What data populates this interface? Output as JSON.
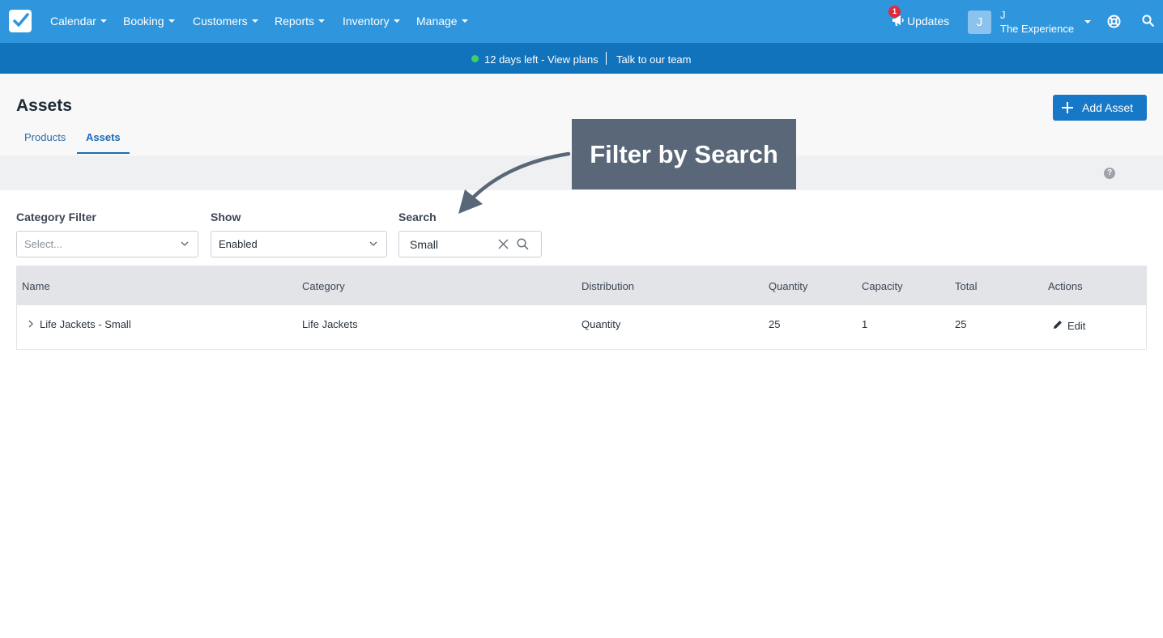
{
  "nav": {
    "items": [
      {
        "label": "Calendar"
      },
      {
        "label": "Booking"
      },
      {
        "label": "Customers"
      },
      {
        "label": "Reports"
      },
      {
        "label": "Inventory"
      },
      {
        "label": "Manage"
      }
    ],
    "updates_label": "Updates",
    "updates_count": "1",
    "user_avatar": "J",
    "user_initial": "J",
    "user_org": "The Experience",
    "icons": [
      "checkbox-logo-icon",
      "megaphone-icon",
      "lifebuoy-icon",
      "search-icon"
    ]
  },
  "banner": {
    "trial_text": "12 days left - View plans",
    "talk_text": "Talk to our team",
    "dot_color": "#3fcf63"
  },
  "page": {
    "title": "Assets",
    "tabs": [
      {
        "label": "Products",
        "active": false
      },
      {
        "label": "Assets",
        "active": true
      }
    ],
    "add_button": "Add Asset",
    "help": "?"
  },
  "callout": {
    "text": "Filter by Search"
  },
  "filters": {
    "category": {
      "label": "Category Filter",
      "value": "Select..."
    },
    "show": {
      "label": "Show",
      "value": "Enabled"
    },
    "search": {
      "label": "Search",
      "value": "Small"
    }
  },
  "table": {
    "columns": [
      "Name",
      "Category",
      "Distribution",
      "Quantity",
      "Capacity",
      "Total",
      "Actions"
    ],
    "rows": [
      {
        "name": "Life Jackets - Small",
        "category": "Life Jackets",
        "distribution": "Quantity",
        "quantity": "25",
        "capacity": "1",
        "total": "25",
        "action": "Edit"
      }
    ]
  },
  "colors": {
    "nav_bg": "#2f96dd",
    "banner_bg": "#1273bd",
    "primary_button": "#1778c7",
    "callout_bg": "#5a6779",
    "badge": "#e02b3c"
  }
}
